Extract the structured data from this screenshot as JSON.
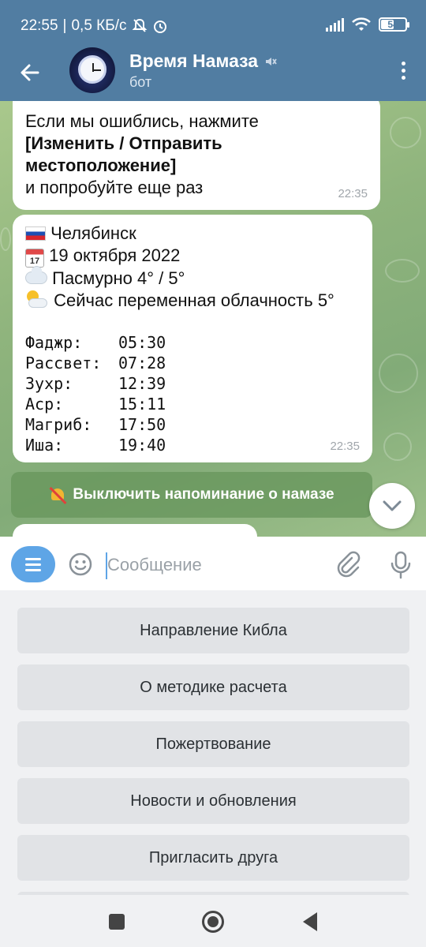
{
  "status_bar": {
    "time": "22:55",
    "speed": "0,5 КБ/с",
    "battery": "54",
    "battery_fraction": 0.54
  },
  "header": {
    "title": "Время Намаза",
    "subtitle": "бот"
  },
  "messages": [
    {
      "lines": [
        "Если мы ошиблись, нажмите"
      ],
      "bold_lines": [
        "[Изменить / Отправить",
        "местоположение]"
      ],
      "tail": "и попробуйте еще раз",
      "time": "22:35"
    },
    {
      "city": "Челябинск",
      "date": "19 октября 2022",
      "weather": "Пасмурно 4° / 5°",
      "now": "Сейчас переменная облачность 5°",
      "prayers": [
        {
          "name": "Фаджр:",
          "time": "05:30"
        },
        {
          "name": "Рассвет:",
          "time": "07:28"
        },
        {
          "name": "Зухр:",
          "time": "12:39"
        },
        {
          "name": "Аср:",
          "time": "15:11"
        },
        {
          "name": "Магриб:",
          "time": "17:50"
        },
        {
          "name": "Иша:",
          "time": "19:40"
        }
      ],
      "time": "22:35"
    }
  ],
  "inline_button": "Выключить напоминание о намазе",
  "input": {
    "placeholder": "Сообщение"
  },
  "keyboard_buttons": [
    "Направление Кибла",
    "О методике расчета",
    "Пожертвование",
    "Новости и обновления",
    "Пригласить друга"
  ],
  "colors": {
    "header": "#517da2",
    "accent": "#5ea5e6",
    "chat_bg": "#8fb47d"
  },
  "icons": [
    "back-arrow-icon",
    "mute-icon",
    "more-icon",
    "bell-off-icon",
    "chevron-down-icon",
    "menu-icon",
    "emoji-icon",
    "attach-icon",
    "mic-icon"
  ]
}
